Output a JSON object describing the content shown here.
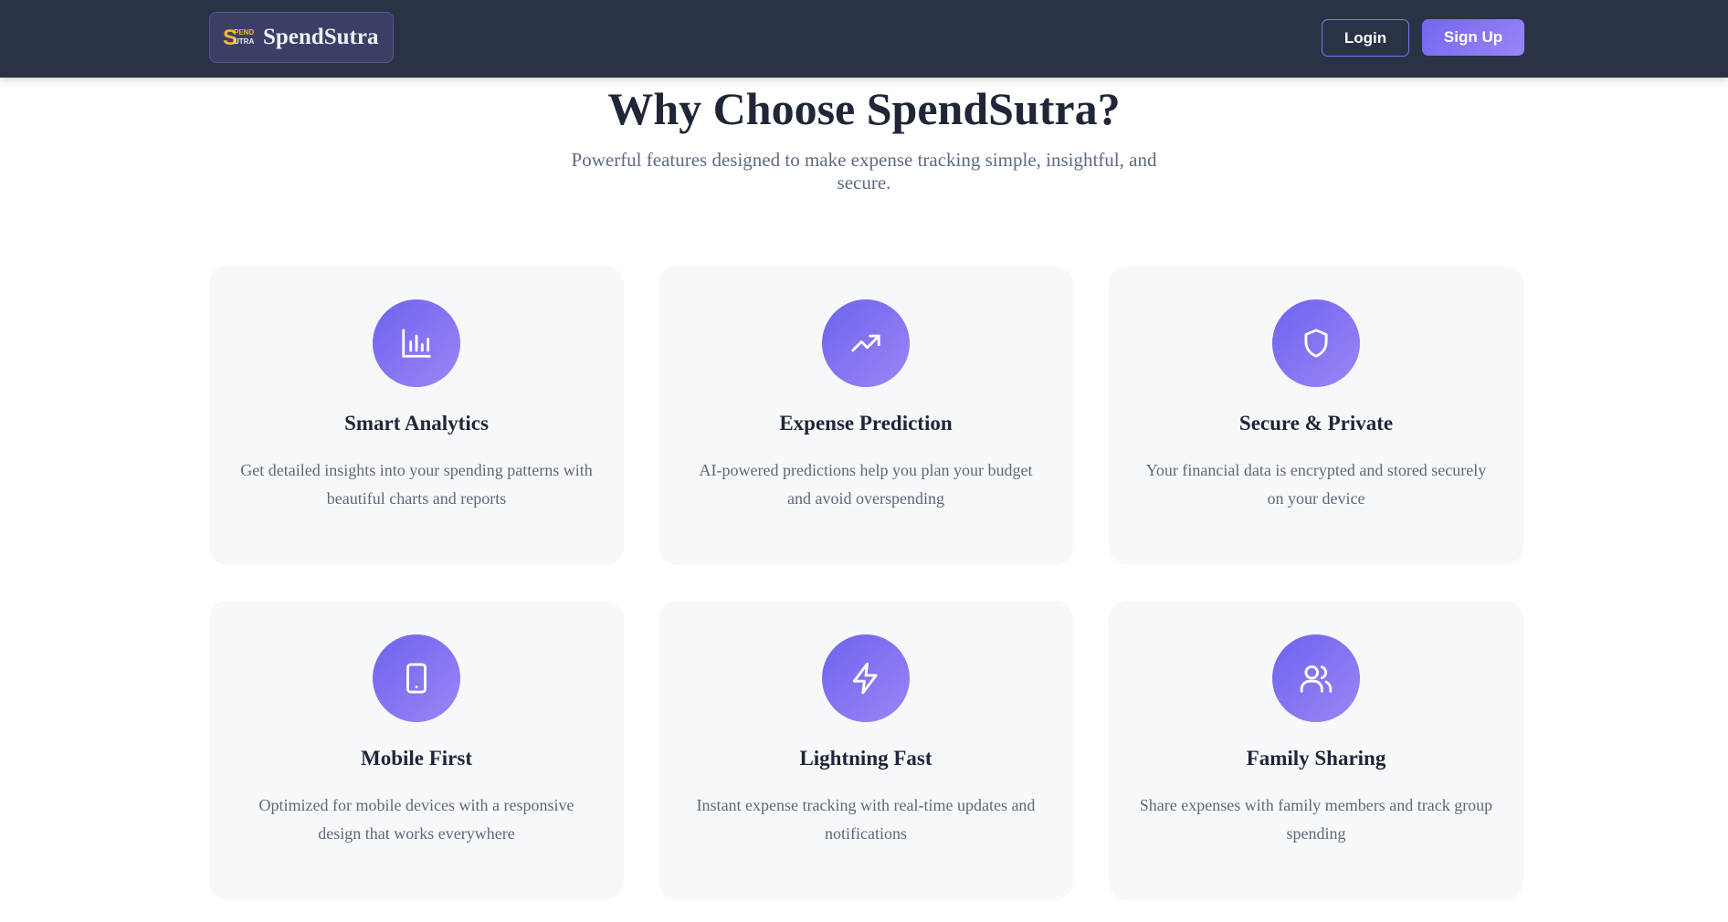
{
  "navbar": {
    "brand": {
      "name": "SpendSutra",
      "logo_text_top": "PEND",
      "logo_text_bottom": "UTRA",
      "logo_colors": {
        "s": "#f5b82e",
        "text": "#e9ecf5"
      }
    },
    "login_label": "Login",
    "signup_label": "Sign Up"
  },
  "features": {
    "title": "Why Choose SpendSutra?",
    "subtitle": "Powerful features designed to make expense tracking simple, insightful, and secure.",
    "cards": [
      {
        "icon": "bar-chart-icon",
        "title": "Smart Analytics",
        "description": "Get detailed insights into your spending patterns with beautiful charts and reports"
      },
      {
        "icon": "trending-up-icon",
        "title": "Expense Prediction",
        "description": "AI-powered predictions help you plan your budget and avoid overspending"
      },
      {
        "icon": "shield-icon",
        "title": "Secure & Private",
        "description": "Your financial data is encrypted and stored securely on your device"
      },
      {
        "icon": "smartphone-icon",
        "title": "Mobile First",
        "description": "Optimized for mobile devices with a responsive design that works everywhere"
      },
      {
        "icon": "lightning-icon",
        "title": "Lightning Fast",
        "description": "Instant expense tracking with real-time updates and notifications"
      },
      {
        "icon": "users-icon",
        "title": "Family Sharing",
        "description": "Share expenses with family members and track group spending"
      }
    ]
  },
  "colors": {
    "navbar_bg": "#2a3346",
    "accent": "#7267ef",
    "accent_light": "#9a85f6",
    "card_bg": "#f7f8fa",
    "heading": "#1f2638",
    "body_text": "#5d6878"
  }
}
